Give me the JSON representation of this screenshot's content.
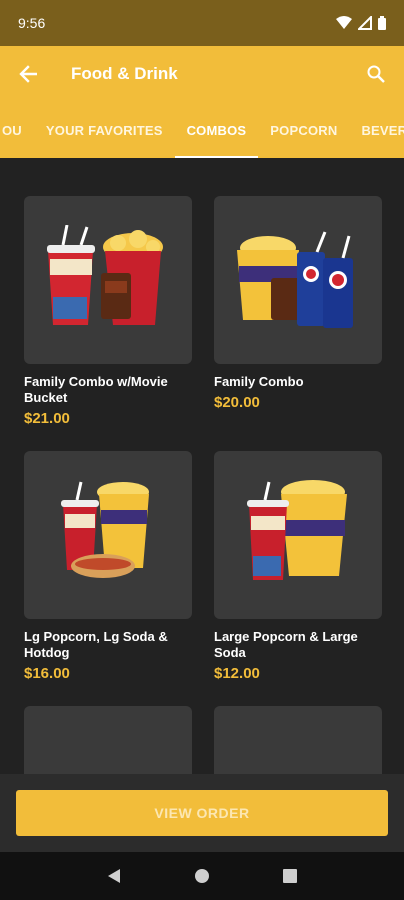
{
  "status": {
    "time": "9:56"
  },
  "appbar": {
    "title": "Food & Drink",
    "back_icon": "arrow-back-icon",
    "search_icon": "search-icon"
  },
  "tabs": [
    {
      "label": "OU"
    },
    {
      "label": "YOUR FAVORITES"
    },
    {
      "label": "COMBOS",
      "active": true
    },
    {
      "label": "POPCORN"
    },
    {
      "label": "BEVERAG"
    }
  ],
  "products": [
    {
      "name": "Family Combo w/Movie Bucket",
      "price": "$21.00",
      "image": "family-combo-movie-bucket"
    },
    {
      "name": "Family Combo",
      "price": "$20.00",
      "image": "family-combo"
    },
    {
      "name": "Lg Popcorn, Lg Soda & Hotdog",
      "price": "$16.00",
      "image": "popcorn-soda-hotdog"
    },
    {
      "name": "Large Popcorn & Large Soda",
      "price": "$12.00",
      "image": "popcorn-soda"
    },
    {
      "name": "",
      "price": "",
      "image": "soda"
    },
    {
      "name": "",
      "price": "",
      "image": "soda"
    }
  ],
  "order": {
    "label": "VIEW ORDER"
  },
  "colors": {
    "accent": "#f2bd3a",
    "status_bar": "#7a5f1c",
    "background": "#222222",
    "card": "#3a3a3a"
  }
}
